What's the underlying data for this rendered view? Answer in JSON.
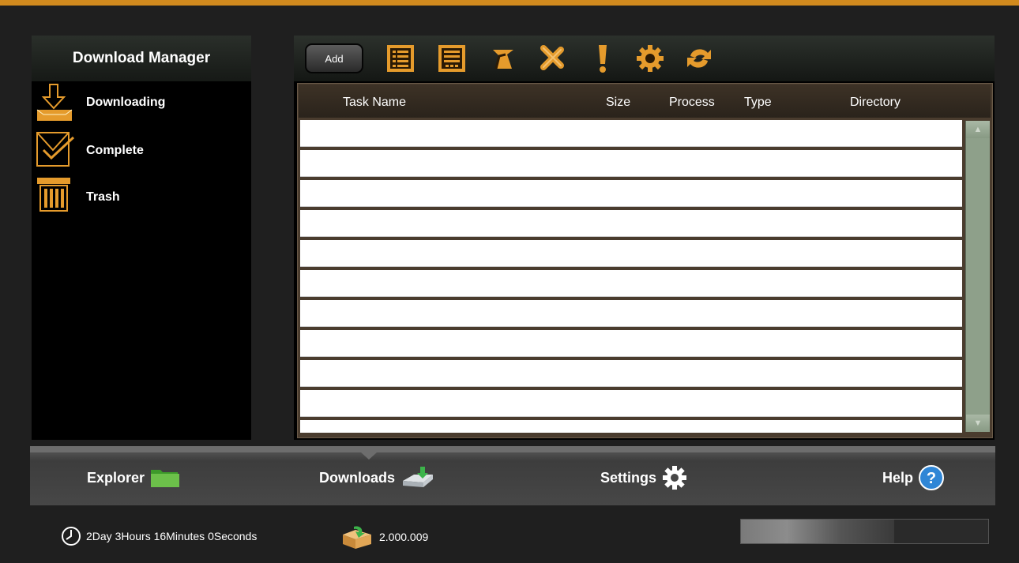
{
  "app": {
    "title": "Download Manager"
  },
  "sidebar": {
    "items": [
      {
        "label": "Downloading",
        "icon": "download-tray-icon"
      },
      {
        "label": "Complete",
        "icon": "complete-envelope-icon"
      },
      {
        "label": "Trash",
        "icon": "trash-bin-icon"
      }
    ]
  },
  "toolbar": {
    "add_label": "Add",
    "icons": [
      "list-detail-icon",
      "list-icon",
      "open-folder-arrow-icon",
      "delete-x-icon",
      "priority-exclamation-icon",
      "gear-icon",
      "refresh-icon"
    ]
  },
  "table": {
    "columns": [
      "Task Name",
      "Size",
      "Process",
      "Type",
      "Directory"
    ],
    "rows": []
  },
  "nav": {
    "items": [
      {
        "label": "Explorer",
        "icon": "folder-icon"
      },
      {
        "label": "Downloads",
        "icon": "download-drive-icon"
      },
      {
        "label": "Settings",
        "icon": "gear-icon"
      },
      {
        "label": "Help",
        "icon": "help-icon"
      }
    ],
    "active": "Downloads"
  },
  "status": {
    "elapsed": "2Day 3Hours 16Minutes 0Seconds",
    "count": "2.000.009",
    "progress_fraction": 0.62
  },
  "colors": {
    "accent": "#d18a1e",
    "icon_orange": "#e59b2c"
  }
}
